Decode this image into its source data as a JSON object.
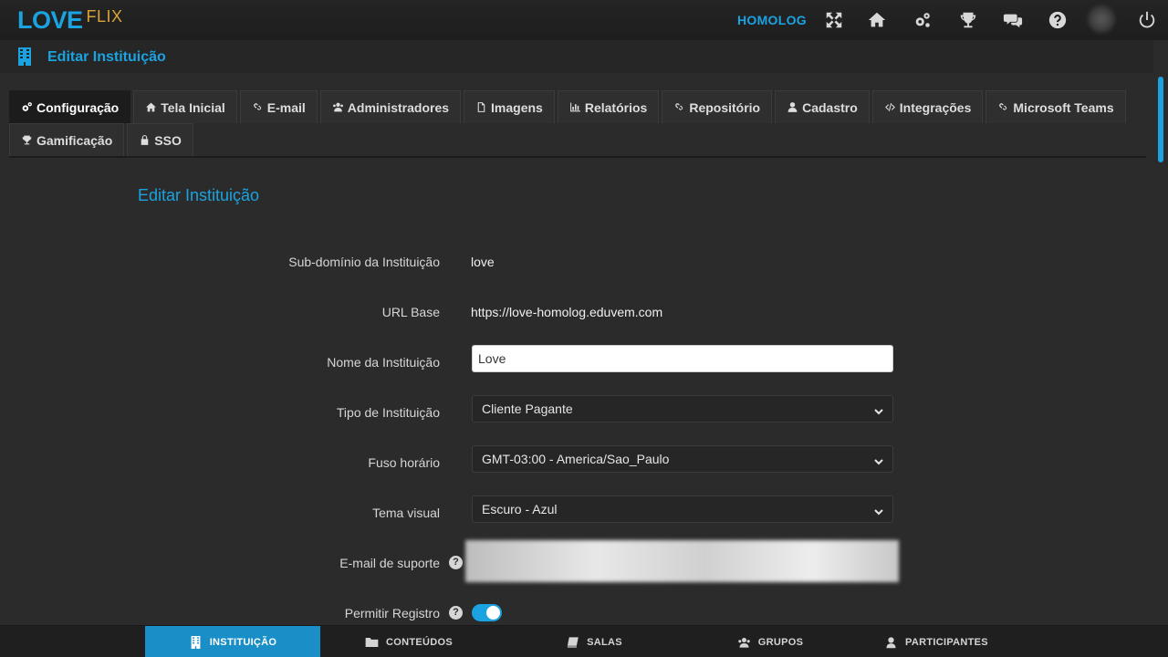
{
  "header": {
    "logo_primary": "LOVE",
    "logo_secondary": "FLIX",
    "environment": "HOMOLOG",
    "icons": [
      "expand-icon",
      "home-icon",
      "gears-icon",
      "trophy-icon",
      "chat-icon",
      "help-icon",
      "power-icon"
    ]
  },
  "page": {
    "title": "Editar Instituição"
  },
  "tabs": [
    {
      "label": "Configuração",
      "icon": "gears-icon",
      "active": true
    },
    {
      "label": "Tela Inicial",
      "icon": "home-icon"
    },
    {
      "label": "E-mail",
      "icon": "link-icon"
    },
    {
      "label": "Administradores",
      "icon": "users-icon"
    },
    {
      "label": "Imagens",
      "icon": "file-icon"
    },
    {
      "label": "Relatórios",
      "icon": "bar-chart-icon"
    },
    {
      "label": "Repositório",
      "icon": "link-icon"
    },
    {
      "label": "Cadastro",
      "icon": "user-icon"
    },
    {
      "label": "Integrações",
      "icon": "code-icon"
    },
    {
      "label": "Microsoft Teams",
      "icon": "link-icon"
    },
    {
      "label": "Gamificação",
      "icon": "trophy-icon"
    },
    {
      "label": "SSO",
      "icon": "lock-icon"
    }
  ],
  "form": {
    "section_title": "Editar Instituição",
    "subdomain_label": "Sub-domínio da Instituição",
    "subdomain_value": "love",
    "base_url_label": "URL Base",
    "base_url_value": "https://love-homolog.eduvem.com",
    "name_label": "Nome da Instituição",
    "name_value": "Love",
    "type_label": "Tipo de Instituição",
    "type_value": "Cliente Pagante",
    "timezone_label": "Fuso horário",
    "timezone_value": "GMT-03:00 - America/Sao_Paulo",
    "theme_label": "Tema visual",
    "theme_value": "Escuro - Azul",
    "support_email_label": "E-mail de suporte",
    "allow_register_label": "Permitir Registro",
    "allow_register_on": true
  },
  "bottom_nav": [
    {
      "label": "INSTITUIÇÃO",
      "icon": "building-icon",
      "active": true
    },
    {
      "label": "CONTEÚDOS",
      "icon": "folder-icon"
    },
    {
      "label": "SALAS",
      "icon": "book-icon"
    },
    {
      "label": "GRUPOS",
      "icon": "users-icon"
    },
    {
      "label": "PARTICIPANTES",
      "icon": "user-icon"
    }
  ],
  "colors": {
    "accent": "#1aa3e0",
    "logo_secondary": "#d9a33a",
    "background": "#2b2b2b",
    "active_nav": "#1a8fc7"
  }
}
